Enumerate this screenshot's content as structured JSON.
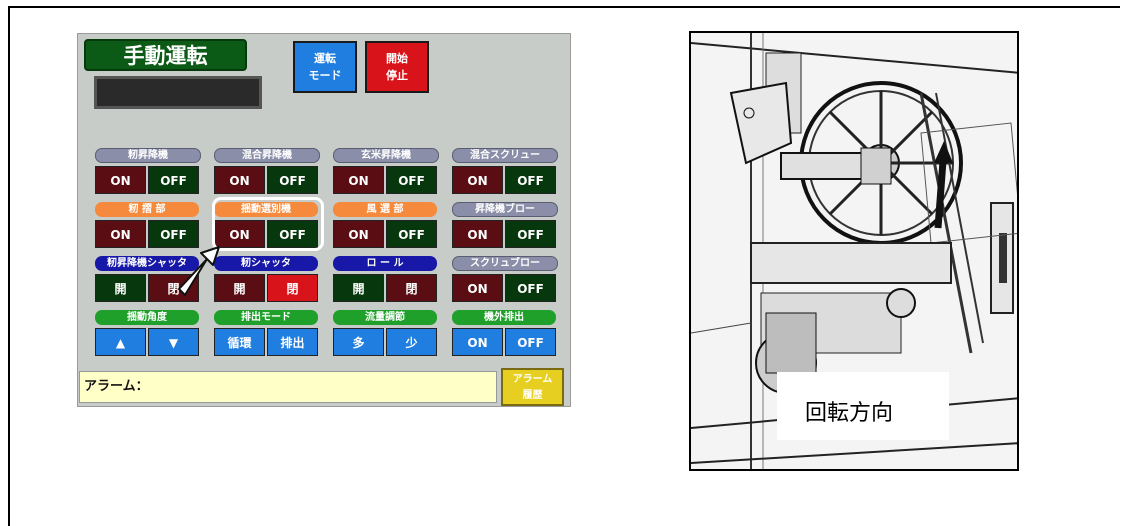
{
  "panel": {
    "title": "手動運転",
    "top_buttons": [
      {
        "line1": "運転",
        "line2": "モード",
        "color": "#1f7ee0"
      },
      {
        "line1": "開始",
        "line2": "停止",
        "color": "#d9131a"
      }
    ],
    "groups": [
      {
        "label": "籾昇降機",
        "label_color": "gray",
        "buttons": [
          "ON",
          "OFF"
        ]
      },
      {
        "label": "混合昇降機",
        "label_color": "gray",
        "buttons": [
          "ON",
          "OFF"
        ]
      },
      {
        "label": "玄米昇降機",
        "label_color": "gray",
        "buttons": [
          "ON",
          "OFF"
        ]
      },
      {
        "label": "混合スクリュー",
        "label_color": "gray",
        "buttons": [
          "ON",
          "OFF"
        ]
      },
      {
        "label": "籾 摺 部",
        "label_color": "orange",
        "buttons": [
          "ON",
          "OFF"
        ]
      },
      {
        "label": "揺動選別機",
        "label_color": "orange",
        "buttons": [
          "ON",
          "OFF"
        ]
      },
      {
        "label": "風 選 部",
        "label_color": "orange",
        "buttons": [
          "ON",
          "OFF"
        ]
      },
      {
        "label": "昇降機ブロー",
        "label_color": "gray",
        "buttons": [
          "ON",
          "OFF"
        ]
      },
      {
        "label": "籾昇降機シャッタ",
        "label_color": "navy",
        "buttons": [
          "開",
          "閉"
        ]
      },
      {
        "label": "籾シャッタ",
        "label_color": "navy",
        "buttons": [
          "開",
          "閉"
        ]
      },
      {
        "label": "ロ ー ル",
        "label_color": "navy",
        "buttons": [
          "開",
          "閉"
        ]
      },
      {
        "label": "スクリュブロー",
        "label_color": "gray",
        "buttons": [
          "ON",
          "OFF"
        ]
      },
      {
        "label": "揺動角度",
        "label_color": "green",
        "buttons": [
          "▲",
          "▼"
        ]
      },
      {
        "label": "排出モード",
        "label_color": "green",
        "buttons": [
          "循環",
          "排出"
        ]
      },
      {
        "label": "流量調節",
        "label_color": "green",
        "buttons": [
          "多",
          "少"
        ]
      },
      {
        "label": "機外排出",
        "label_color": "green",
        "buttons": [
          "ON",
          "OFF"
        ]
      }
    ],
    "alarm_label": "アラーム：",
    "alarm_history_line1": "アラーム",
    "alarm_history_line2": "履歴"
  },
  "photo": {
    "caption": "回転方向"
  },
  "colors": {
    "on_dark": "#5a0d12",
    "off_dark": "#07380d",
    "blue": "#1f7ee0",
    "red": "#d9131a"
  }
}
